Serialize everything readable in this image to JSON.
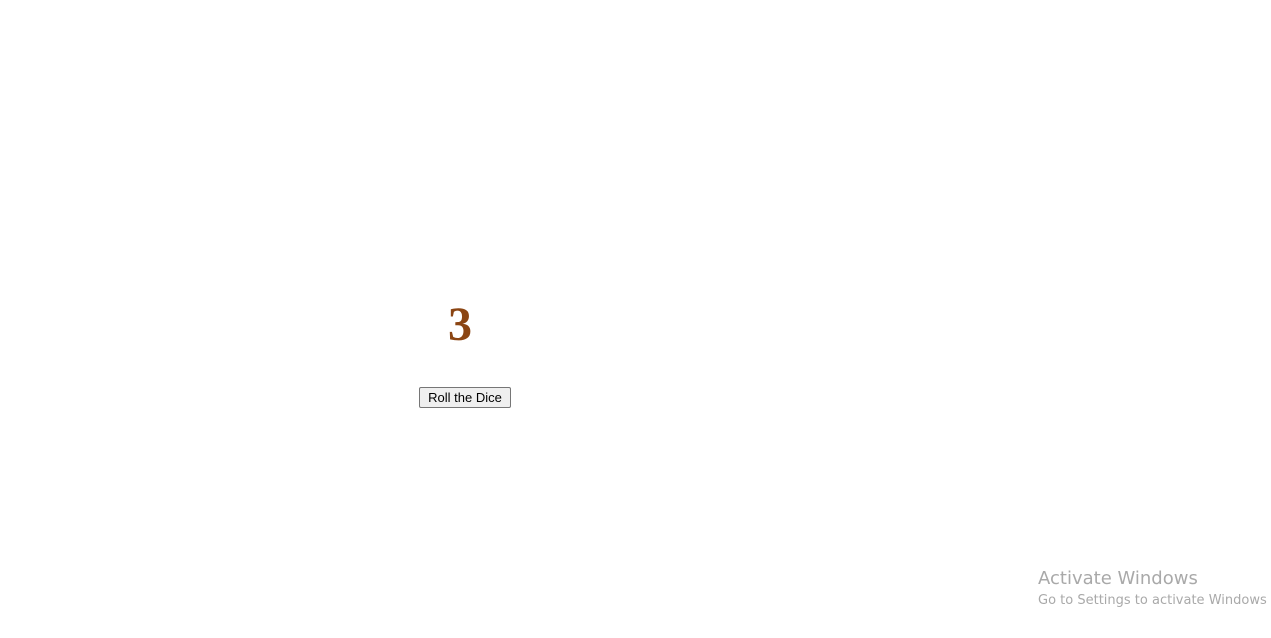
{
  "dice": {
    "value": "3",
    "color": "#8b4513"
  },
  "controls": {
    "roll_label": "Roll the Dice"
  },
  "watermark": {
    "title": "Activate Windows",
    "subtitle": "Go to Settings to activate Windows"
  }
}
